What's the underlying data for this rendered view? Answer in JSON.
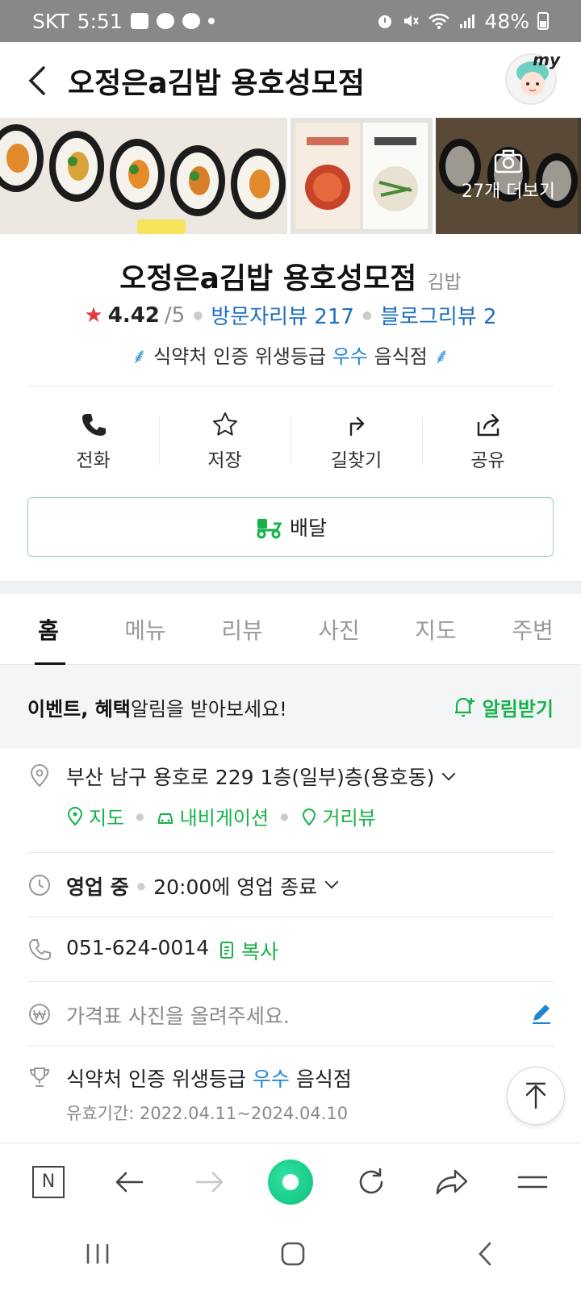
{
  "status_bar": {
    "carrier": "SKT",
    "time": "5:51",
    "battery": "48%",
    "icons": [
      "gallery-icon",
      "talk-icon",
      "chat-icon",
      "dot-icon",
      "alarm-icon",
      "mute-icon",
      "wifi-icon",
      "signal-icon",
      "battery-icon"
    ]
  },
  "header": {
    "title": "오정은a김밥 용호성모점",
    "avatar_label": "my"
  },
  "photos": {
    "more_label": "27개 더보기"
  },
  "place": {
    "name": "오정은a김밥 용호성모점",
    "category": "김밥",
    "rating": "4.42",
    "rating_max": "/5",
    "visitor_reviews": "방문자리뷰 217",
    "blog_reviews": "블로그리뷰 2",
    "hygiene_prefix": "식약처 인증 위생등급",
    "hygiene_grade": "우수",
    "hygiene_suffix": "음식점"
  },
  "actions": [
    {
      "label": "전화",
      "icon": "phone-icon"
    },
    {
      "label": "저장",
      "icon": "star-outline-icon"
    },
    {
      "label": "길찾기",
      "icon": "directions-icon"
    },
    {
      "label": "공유",
      "icon": "share-icon"
    }
  ],
  "delivery": {
    "label": "배달",
    "icon": "delivery-scooter-icon"
  },
  "tabs": [
    "홈",
    "메뉴",
    "리뷰",
    "사진",
    "지도",
    "주변"
  ],
  "active_tab": "홈",
  "notify": {
    "bold_text": "이벤트, 혜택",
    "text": " 알림을 받아보세요!",
    "cta": "알림받기"
  },
  "info": {
    "address": "부산 남구 용호로 229 1층(일부)층(용호동)",
    "map_link": "지도",
    "navi_link": "내비게이션",
    "street_link": "거리뷰",
    "hours_status": "영업 중",
    "hours_detail": "20:00에 영업 종료",
    "phone": "051-624-0014",
    "copy_label": "복사",
    "price_placeholder": "가격표 사진을 올려주세요.",
    "cert_prefix": "식약처 인증 위생등급",
    "cert_grade": "우수",
    "cert_suffix": "음식점",
    "cert_period": "유효기간: 2022.04.11~2024.04.10"
  },
  "browser_bar": {
    "home_label": "N"
  },
  "colors": {
    "green": "#17b24a",
    "blue": "#1f6fbf",
    "hygiene_blue": "#1f86d6",
    "star_red": "#e23b3b"
  }
}
